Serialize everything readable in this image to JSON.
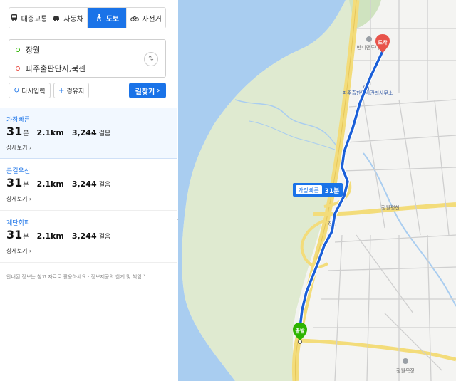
{
  "modes": [
    {
      "label": "대중교통",
      "icon": "bus-icon",
      "active": false
    },
    {
      "label": "자동차",
      "icon": "car-icon",
      "active": false
    },
    {
      "label": "도보",
      "icon": "walk-icon",
      "active": true
    },
    {
      "label": "자전거",
      "icon": "bicycle-icon",
      "active": false
    }
  ],
  "search": {
    "origin": "장월",
    "destination": "파주출판단지,북센",
    "origin_color": "#2db400",
    "destination_color": "#e8534a"
  },
  "buttons": {
    "reset_label": "다시입력",
    "waypoint_label": "경유지",
    "find_label": "길찾기"
  },
  "routes": [
    {
      "label": "가장빠른",
      "minutes": "31",
      "minute_unit": "분",
      "distance": "2.1km",
      "steps": "3,244",
      "steps_unit": "걸음",
      "detail": "상세보기",
      "selected": true
    },
    {
      "label": "큰길우선",
      "minutes": "31",
      "minute_unit": "분",
      "distance": "2.1km",
      "steps": "3,244",
      "steps_unit": "걸음",
      "detail": "상세보기",
      "selected": false
    },
    {
      "label": "계단회피",
      "minutes": "31",
      "minute_unit": "분",
      "distance": "2.1km",
      "steps": "3,244",
      "steps_unit": "걸음",
      "detail": "상세보기",
      "selected": false
    }
  ],
  "footer": "안내된 정보는 참고 자료로 활용하세요 · 정보제공의 한계 및 책임",
  "map": {
    "route_badge_label": "가장빠른",
    "route_badge_time": "31분",
    "start_marker": "출발",
    "end_marker": "도착",
    "labels": {
      "landmark_top": "반디앤루니스",
      "office": "파주출판도시관리사무소",
      "bridge": "장월평천",
      "interchange": "장월",
      "bottom": "장월목장"
    },
    "colors": {
      "route": "#1a5fd8",
      "water": "#a9cdf0",
      "park": "#dfead0",
      "road": "#f3dc7a",
      "land": "#f4f4f2"
    }
  }
}
